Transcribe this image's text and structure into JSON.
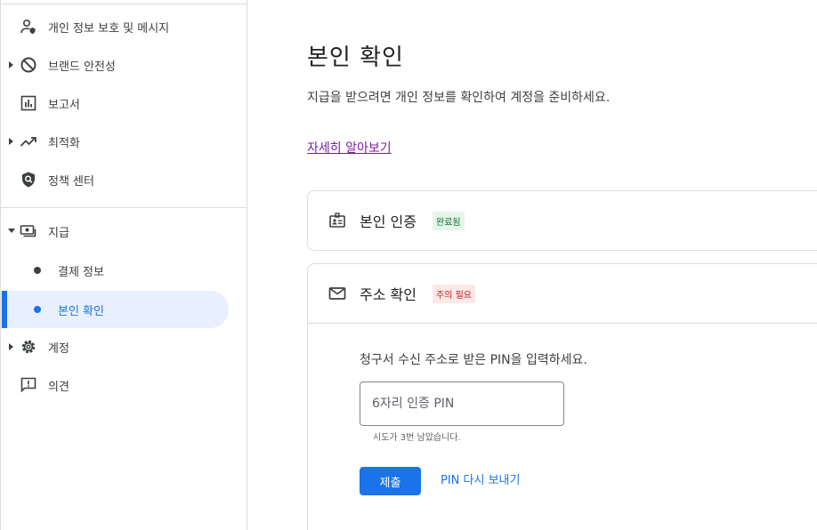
{
  "sidebar": {
    "items": [
      {
        "label": "개인 정보 보호 및 메시지",
        "icon": "person-shield-icon"
      },
      {
        "label": "브랜드 안전성",
        "icon": "block-icon"
      },
      {
        "label": "보고서",
        "icon": "bar-chart-icon"
      },
      {
        "label": "최적화",
        "icon": "trending-up-icon"
      },
      {
        "label": "정책 센터",
        "icon": "policy-shield-icon"
      },
      {
        "label": "지급",
        "icon": "payments-icon"
      },
      {
        "label": "계정",
        "icon": "gear-icon"
      },
      {
        "label": "의견",
        "icon": "feedback-icon"
      }
    ],
    "sub_items": [
      {
        "label": "결제 정보",
        "active": false
      },
      {
        "label": "본인 확인",
        "active": true
      }
    ]
  },
  "main": {
    "title": "본인 확인",
    "description": "지급을 받으려면 개인 정보를 확인하여 계정을 준비하세요.",
    "learn_more": "자세히 알아보기",
    "cards": [
      {
        "title": "본인 인증",
        "badge": "완료됨",
        "icon": "id-badge-icon"
      },
      {
        "title": "주소 확인",
        "badge": "주의 필요",
        "icon": "mail-icon"
      }
    ],
    "address": {
      "instruction": "청구서 수신 주소로 받은 PIN을 입력하세요.",
      "pin_placeholder": "6자리 인증 PIN",
      "helper": "시도가 3번 남았습니다.",
      "submit_label": "제출",
      "resend_label": "PIN 다시 보내기"
    }
  },
  "colors": {
    "accent": "#1a73e8",
    "active_bg": "#e8f0fe",
    "success_bg": "#e6f4ea",
    "success_text": "#137333",
    "warn_bg": "#fce8e6",
    "warn_text": "#c5221f",
    "link_visited": "#7b1fa2"
  }
}
